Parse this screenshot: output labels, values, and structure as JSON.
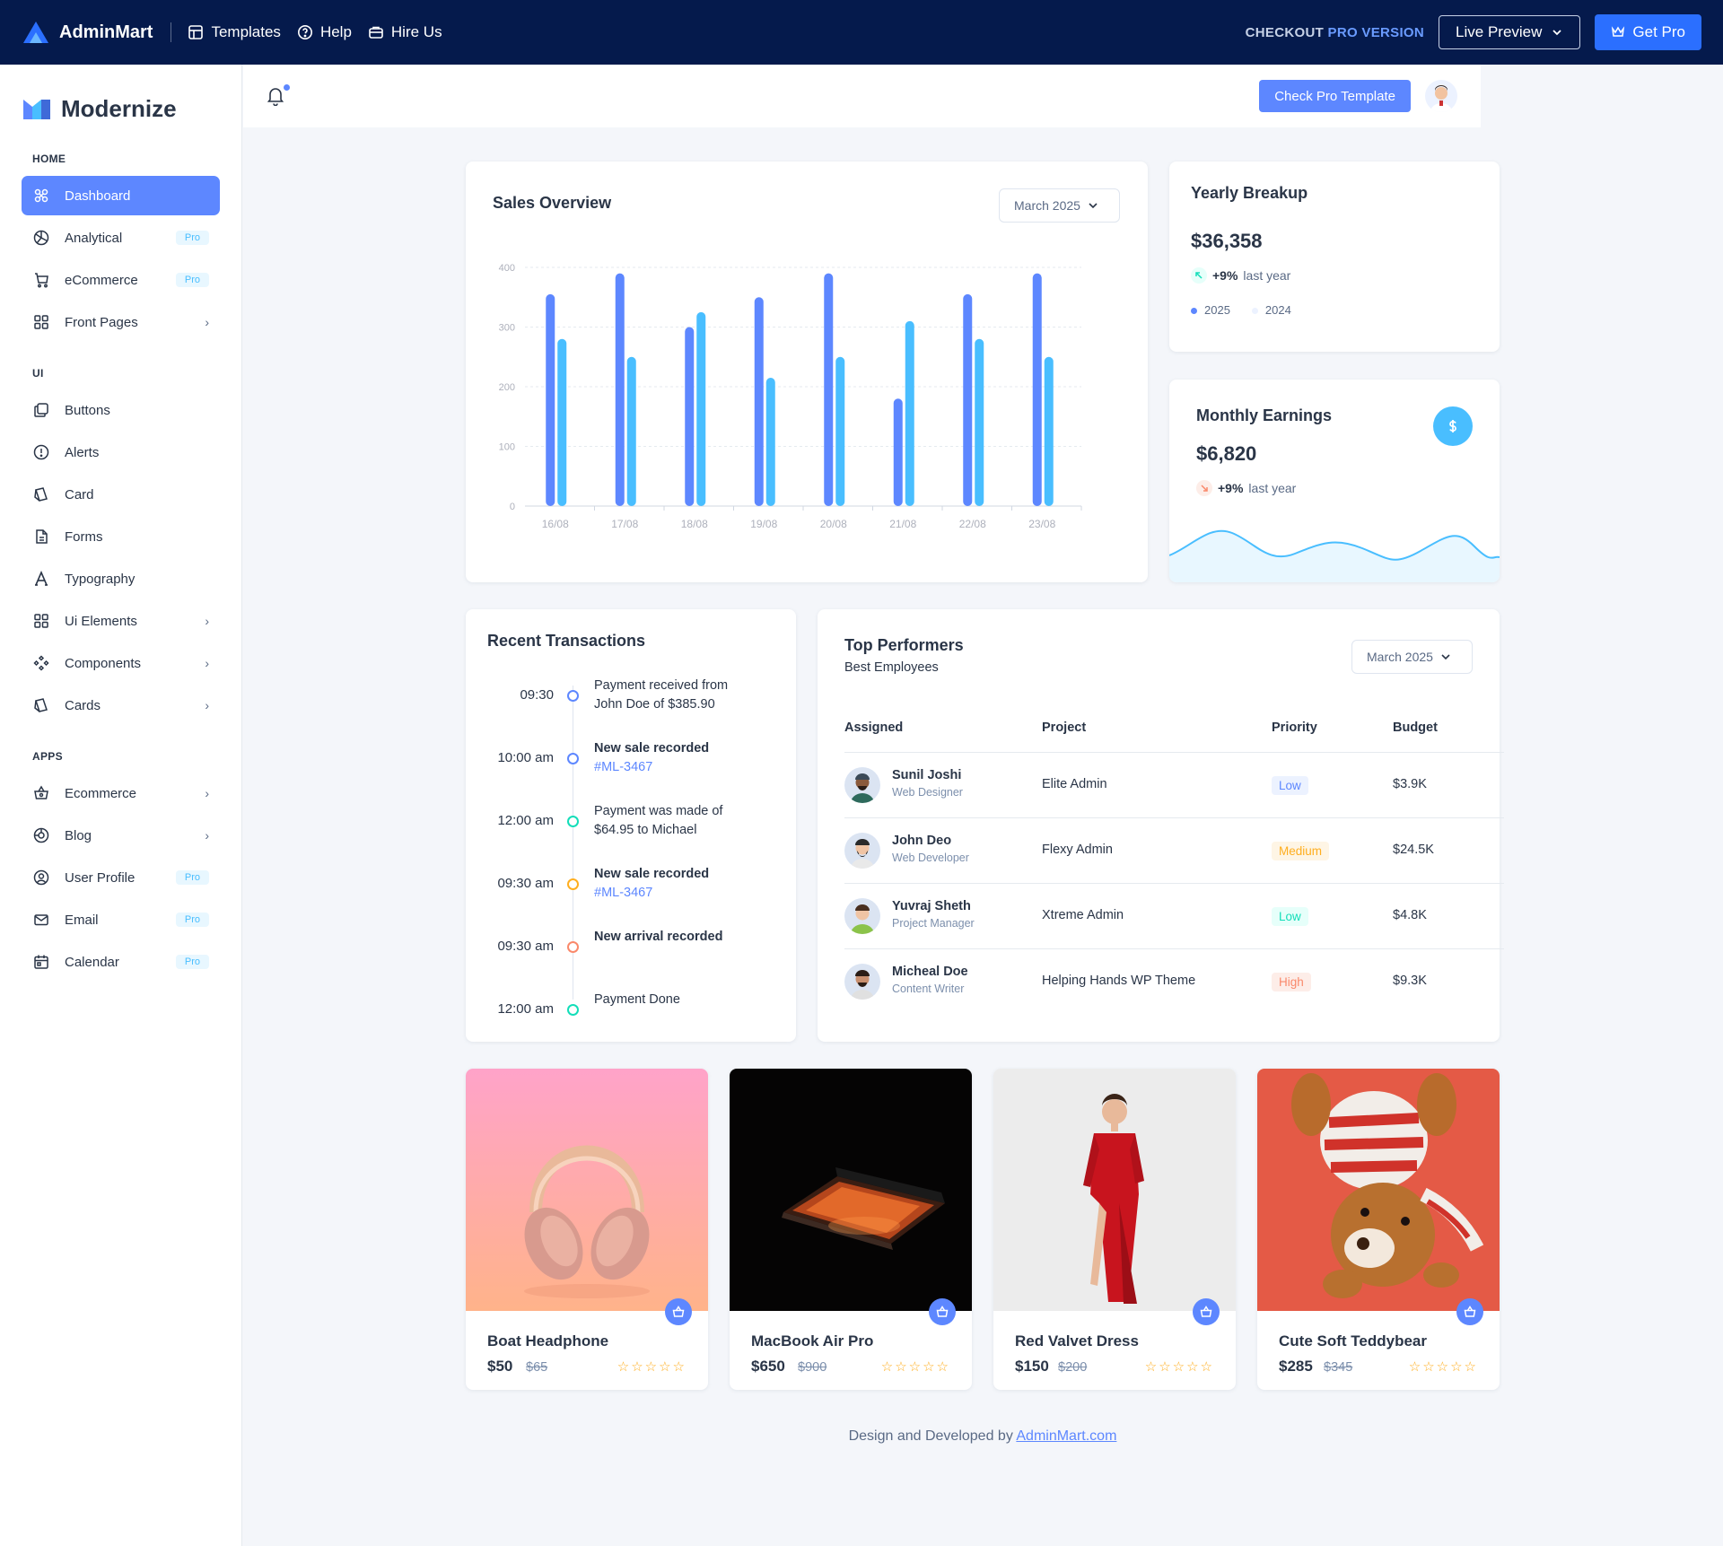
{
  "topbar": {
    "brand": "AdminMart",
    "links": [
      "Templates",
      "Help",
      "Hire Us"
    ],
    "checkout_text": "CHECKOUT",
    "checkout_pro": "PRO VERSION",
    "live_preview": "Live Preview",
    "get_pro": "Get Pro"
  },
  "sidebar": {
    "brand": "Modernize",
    "sections": {
      "home": "HOME",
      "ui": "UI",
      "apps": "APPS"
    },
    "home_items": [
      {
        "label": "Dashboard",
        "icon": "aperture-icon",
        "active": true
      },
      {
        "label": "Analytical",
        "icon": "chart-icon",
        "badge": "Pro"
      },
      {
        "label": "eCommerce",
        "icon": "shopping-cart-icon",
        "badge": "Pro"
      },
      {
        "label": "Front Pages",
        "icon": "layout-grid-icon",
        "chevron": true
      }
    ],
    "ui_items": [
      {
        "label": "Buttons",
        "icon": "copy-icon"
      },
      {
        "label": "Alerts",
        "icon": "alert-circle-icon"
      },
      {
        "label": "Card",
        "icon": "cards-icon"
      },
      {
        "label": "Forms",
        "icon": "file-text-icon"
      },
      {
        "label": "Typography",
        "icon": "typography-icon"
      },
      {
        "label": "Ui Elements",
        "icon": "layout-grid-icon",
        "chevron": true
      },
      {
        "label": "Components",
        "icon": "components-icon",
        "chevron": true
      },
      {
        "label": "Cards",
        "icon": "cards-icon",
        "chevron": true
      }
    ],
    "apps_items": [
      {
        "label": "Ecommerce",
        "icon": "basket-icon",
        "chevron": true
      },
      {
        "label": "Blog",
        "icon": "blog-icon",
        "chevron": true
      },
      {
        "label": "User Profile",
        "icon": "user-circle-icon",
        "badge": "Pro"
      },
      {
        "label": "Email",
        "icon": "mail-icon",
        "badge": "Pro"
      },
      {
        "label": "Calendar",
        "icon": "calendar-icon",
        "badge": "Pro"
      }
    ]
  },
  "header": {
    "check_pro": "Check Pro Template"
  },
  "sales": {
    "title": "Sales Overview",
    "select": "March 2025"
  },
  "chart_data": {
    "type": "bar",
    "categories": [
      "16/08",
      "17/08",
      "18/08",
      "19/08",
      "20/08",
      "21/08",
      "22/08",
      "23/08"
    ],
    "series": [
      {
        "values": [
          355,
          390,
          300,
          350,
          390,
          180,
          355,
          390
        ],
        "color": "#5d87ff"
      },
      {
        "values": [
          280,
          250,
          325,
          215,
          250,
          310,
          280,
          250
        ],
        "color": "#49beff"
      }
    ],
    "ylim": [
      0,
      400
    ],
    "yticks": [
      "0",
      "100",
      "200",
      "300",
      "400"
    ],
    "grid": true
  },
  "yearly": {
    "title": "Yearly Breakup",
    "amount": "$36,358",
    "change": "+9%",
    "change_label": "last year",
    "legend": [
      "2025",
      "2024"
    ]
  },
  "monthly": {
    "title": "Monthly Earnings",
    "amount": "$6,820",
    "change": "+9%",
    "change_label": "last year"
  },
  "transactions": {
    "title": "Recent Transactions",
    "items": [
      {
        "time": "09:30",
        "line1": "Payment received from",
        "line2": "John Doe of $385.90",
        "color": "#5d87ff"
      },
      {
        "time": "10:00 am",
        "line1": "New sale recorded",
        "link": "#ML-3467",
        "color": "#5d87ff"
      },
      {
        "time": "12:00 am",
        "line1": "Payment was made of",
        "line2": "$64.95 to Michael",
        "color": "#13deb9"
      },
      {
        "time": "09:30 am",
        "line1": "New sale recorded",
        "link": "#ML-3467",
        "color": "#ffae1f"
      },
      {
        "time": "09:30 am",
        "line1": "New arrival recorded",
        "color": "#fa896b"
      },
      {
        "time": "12:00 am",
        "line1": "Payment Done",
        "color": "#13deb9"
      }
    ]
  },
  "performers": {
    "title": "Top Performers",
    "subtitle": "Best Employees",
    "select": "March 2025",
    "columns": [
      "Assigned",
      "Project",
      "Priority",
      "Budget"
    ],
    "rows": [
      {
        "name": "Sunil Joshi",
        "role": "Web Designer",
        "project": "Elite Admin",
        "priority": "Low",
        "priority_color": "#5d87ff",
        "priority_bg": "#ecf2ff",
        "budget": "$3.9K"
      },
      {
        "name": "John Deo",
        "role": "Web Developer",
        "project": "Flexy Admin",
        "priority": "Medium",
        "priority_color": "#ffae1f",
        "priority_bg": "#fef5e5",
        "budget": "$24.5K"
      },
      {
        "name": "Yuvraj Sheth",
        "role": "Project Manager",
        "project": "Xtreme Admin",
        "priority": "Low",
        "priority_color": "#13deb9",
        "priority_bg": "#e6fffa",
        "budget": "$4.8K"
      },
      {
        "name": "Micheal Doe",
        "role": "Content Writer",
        "project": "Helping Hands WP Theme",
        "priority": "High",
        "priority_color": "#fa896b",
        "priority_bg": "#fdede8",
        "budget": "$9.3K"
      }
    ]
  },
  "products": [
    {
      "name": "Boat Headphone",
      "price": "$50",
      "old": "$65",
      "stars": "☆☆☆☆☆"
    },
    {
      "name": "MacBook Air Pro",
      "price": "$650",
      "old": "$900",
      "stars": "☆☆☆☆☆"
    },
    {
      "name": "Red Valvet Dress",
      "price": "$150",
      "old": "$200",
      "stars": "☆☆☆☆☆"
    },
    {
      "name": "Cute Soft Teddybear",
      "price": "$285",
      "old": "$345",
      "stars": "☆☆☆☆☆"
    }
  ],
  "footer": {
    "text": "Design and Developed by",
    "link": "AdminMart.com"
  }
}
